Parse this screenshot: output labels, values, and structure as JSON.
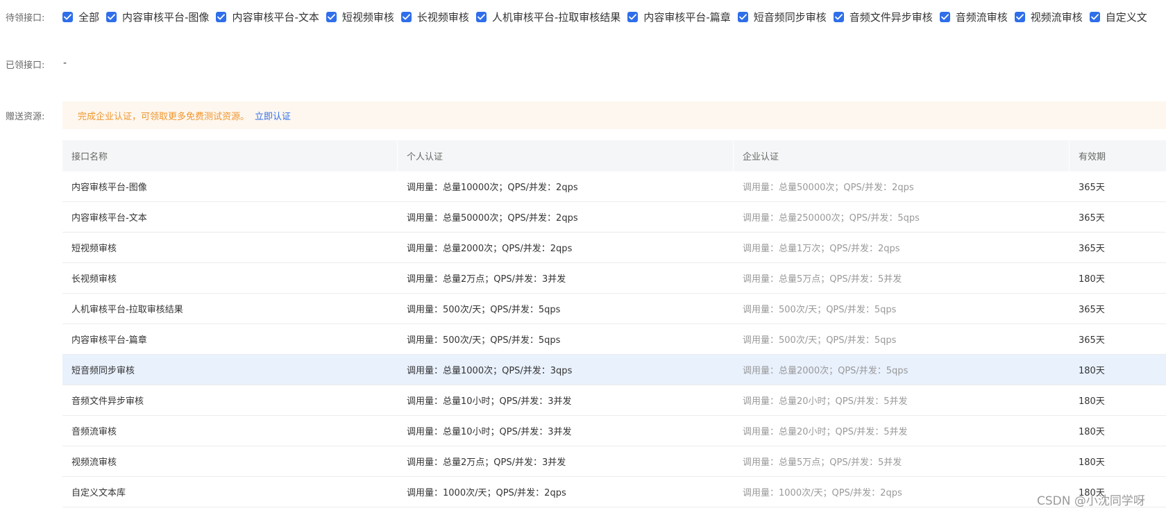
{
  "pending": {
    "label": "待领接口:",
    "options": [
      {
        "label": "全部",
        "checked": true
      },
      {
        "label": "内容审核平台-图像",
        "checked": true
      },
      {
        "label": "内容审核平台-文本",
        "checked": true
      },
      {
        "label": "短视频审核",
        "checked": true
      },
      {
        "label": "长视频审核",
        "checked": true
      },
      {
        "label": "人机审核平台-拉取审核结果",
        "checked": true
      },
      {
        "label": "内容审核平台-篇章",
        "checked": true
      },
      {
        "label": "短音频同步审核",
        "checked": true
      },
      {
        "label": "音频文件异步审核",
        "checked": true
      },
      {
        "label": "音频流审核",
        "checked": true
      },
      {
        "label": "视频流审核",
        "checked": true
      },
      {
        "label": "自定义文",
        "checked": true
      }
    ]
  },
  "claimed": {
    "label": "已领接口:",
    "value": "-"
  },
  "gift": {
    "label": "赠送资源:",
    "notice_text": "完成企业认证，可领取更多免费测试资源。",
    "notice_link": "立即认证"
  },
  "table": {
    "headers": [
      "接口名称",
      "个人认证",
      "企业认证",
      "有效期"
    ],
    "highlighted_row": 6,
    "rows": [
      [
        "内容审核平台-图像",
        "调用量：总量10000次；QPS/并发：2qps",
        "调用量：总量50000次；QPS/并发：2qps",
        "365天"
      ],
      [
        "内容审核平台-文本",
        "调用量：总量50000次；QPS/并发：2qps",
        "调用量：总量250000次；QPS/并发：5qps",
        "365天"
      ],
      [
        "短视频审核",
        "调用量：总量2000次；QPS/并发：2qps",
        "调用量：总量1万次；QPS/并发：2qps",
        "365天"
      ],
      [
        "长视频审核",
        "调用量：总量2万点；QPS/并发：3并发",
        "调用量：总量5万点；QPS/并发：5并发",
        "180天"
      ],
      [
        "人机审核平台-拉取审核结果",
        "调用量：500次/天；QPS/并发：5qps",
        "调用量：500次/天；QPS/并发：5qps",
        "365天"
      ],
      [
        "内容审核平台-篇章",
        "调用量：500次/天；QPS/并发：5qps",
        "调用量：500次/天；QPS/并发：5qps",
        "365天"
      ],
      [
        "短音频同步审核",
        "调用量：总量1000次；QPS/并发：3qps",
        "调用量：总量2000次；QPS/并发：5qps",
        "180天"
      ],
      [
        "音频文件异步审核",
        "调用量：总量10小时；QPS/并发：3并发",
        "调用量：总量20小时；QPS/并发：5并发",
        "180天"
      ],
      [
        "音频流审核",
        "调用量：总量10小时；QPS/并发：3并发",
        "调用量：总量20小时；QPS/并发：5并发",
        "180天"
      ],
      [
        "视频流审核",
        "调用量：总量2万点；QPS/并发：3并发",
        "调用量：总量5万点；QPS/并发：5并发",
        "180天"
      ],
      [
        "自定义文本库",
        "调用量：1000次/天；QPS/并发：2qps",
        "调用量：1000次/天；QPS/并发：2qps",
        "180天"
      ]
    ]
  },
  "watermark": "CSDN @小沈同学呀",
  "colors": {
    "checkbox": "#2f6eea",
    "link": "#2f6eea",
    "notice_text": "#f0962e",
    "notice_bg": "#fef7ef",
    "row_highlight": "#e9f1fd"
  },
  "icons": {
    "checkbox": "checkmark-icon"
  }
}
